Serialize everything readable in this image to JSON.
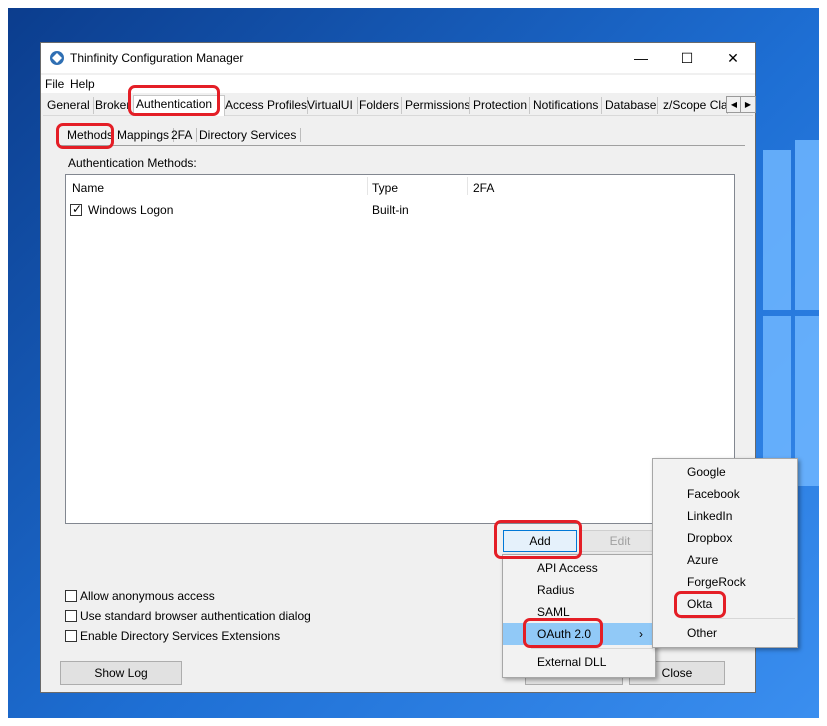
{
  "window": {
    "title": "Thinfinity Configuration Manager"
  },
  "menubar": [
    "File",
    "Help"
  ],
  "tabs": [
    "General",
    "Broker",
    "Authentication",
    "Access Profiles",
    "VirtualUI",
    "Folders",
    "Permissions",
    "Protection",
    "Notifications",
    "Database",
    "z/Scope Clas"
  ],
  "subtabs": [
    "Methods",
    "Mappings",
    "2FA",
    "Directory Services"
  ],
  "auth_section": {
    "label": "Authentication Methods:",
    "columns": [
      "Name",
      "Type",
      "2FA"
    ],
    "rows": [
      {
        "name": "Windows Logon",
        "type": "Built-in",
        "twofa": "",
        "checked": true
      }
    ]
  },
  "options": [
    {
      "label": "Allow anonymous access",
      "checked": false
    },
    {
      "label": "Use standard browser authentication dialog",
      "checked": false
    },
    {
      "label": "Enable Directory Services Extensions",
      "checked": false
    }
  ],
  "buttons": {
    "add": "Add",
    "edit": "Edit",
    "show_log": "Show Log",
    "close": "Close"
  },
  "add_menu": [
    "API Access",
    "Radius",
    "SAML",
    "OAuth 2.0",
    "External DLL"
  ],
  "oauth_menu": [
    "Google",
    "Facebook",
    "LinkedIn",
    "Dropbox",
    "Azure",
    "ForgeRock",
    "Okta",
    "Other"
  ],
  "colors": {
    "highlight_ring": "#e41e26",
    "menu_hover": "#91c9f7",
    "desktop": "#1e6fd4"
  }
}
